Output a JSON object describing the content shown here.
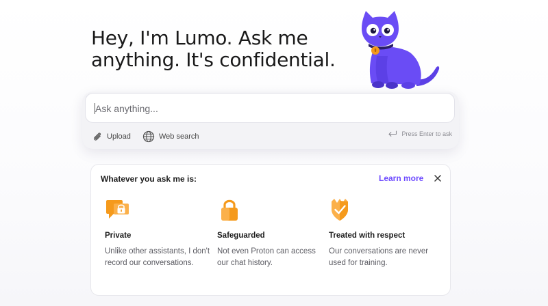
{
  "hero": {
    "headline": "Hey, I'm Lumo. Ask me anything. It's confidential."
  },
  "composer": {
    "placeholder": "Ask anything...",
    "upload_label": "Upload",
    "web_search_label": "Web search",
    "enter_hint": "Press Enter to ask"
  },
  "info_card": {
    "title": "Whatever you ask me is:",
    "learn_more": "Learn more",
    "features": [
      {
        "icon": "chat-lock-icon",
        "title": "Private",
        "text": "Unlike other assistants, I don't record our conversations."
      },
      {
        "icon": "padlock-icon",
        "title": "Safeguarded",
        "text": "Not even Proton can access our chat history."
      },
      {
        "icon": "shield-check-icon",
        "title": "Treated with respect",
        "text": "Our conversations are never used for training."
      }
    ]
  },
  "colors": {
    "accent": "#6d4aff",
    "icon_orange": "#f59a1c",
    "mascot_purple": "#6a4cf5"
  }
}
